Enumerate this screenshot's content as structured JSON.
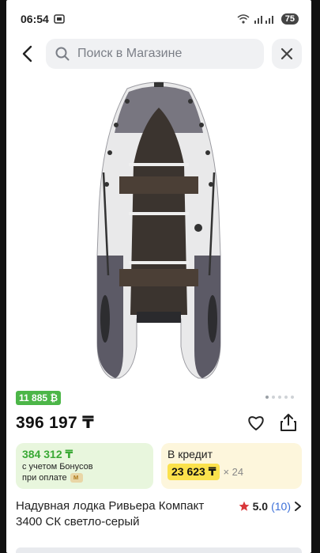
{
  "status": {
    "time": "06:54",
    "battery": "75"
  },
  "search": {
    "placeholder": "Поиск в Магазине"
  },
  "gallery": {
    "badge": "11 885 ₿",
    "dots": 5,
    "active_dot": 0
  },
  "price": "396 197 ₸",
  "bonus_card": {
    "amount": "384 312 ₸",
    "line1": "с учетом Бонусов",
    "line2": "при оплате"
  },
  "credit_card": {
    "title": "В кредит",
    "monthly": "23 623 ₸",
    "months": "× 24"
  },
  "product": {
    "title": "Надувная лодка Ривьера Компакт 3400 СК светло-серый"
  },
  "rating": {
    "value": "5.0",
    "count": "(10)"
  },
  "colors": {
    "accent_green": "#4cb648",
    "credit_yellow": "#fbe14c",
    "link_blue": "#3b6fd8",
    "star_red": "#d9373a"
  }
}
